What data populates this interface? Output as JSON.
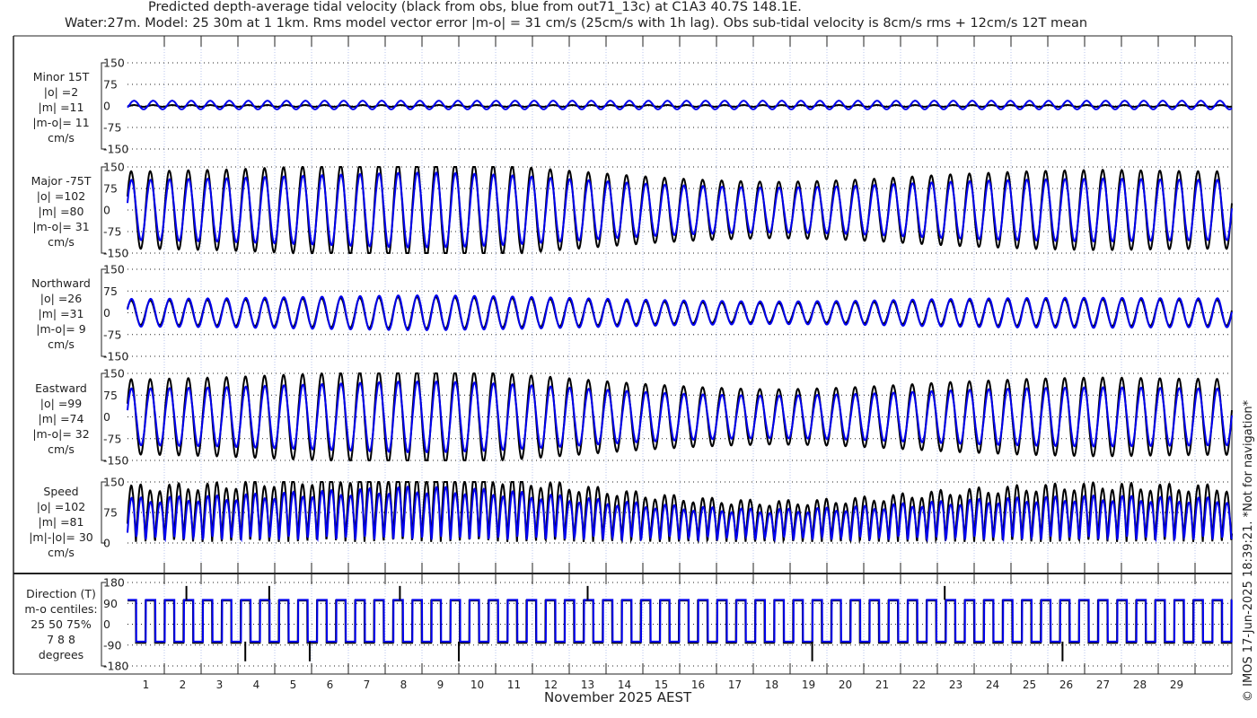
{
  "title_line1": "Predicted depth-average tidal velocity (black from obs, blue from out71_13c) at C1A3 40.7S 148.1E.",
  "title_line2": "Water:27m. Model: 25 30m at 1 1km. Rms model vector error |m-o| = 31 cm/s (25cm/s with 1h lag). Obs sub-tidal velocity is 8cm/s rms + 12cm/s 12T mean",
  "xlabel": "November 2025 AEST",
  "copyright": "© IMOS 17-Jun-2025 18:39:21. *Not for navigation*",
  "colors": {
    "obs": "#000000",
    "model": "#0000ee",
    "grid": "#000000",
    "vgrid": "#b8c4ee"
  },
  "chart_data": {
    "type": "line",
    "x_unit": "day of November 2025",
    "xlim": [
      1,
      31
    ],
    "x_tick_labels": [
      "1",
      "2",
      "3",
      "4",
      "5",
      "6",
      "7",
      "8",
      "9",
      "10",
      "11",
      "12",
      "13",
      "14",
      "15",
      "16",
      "17",
      "18",
      "19",
      "20",
      "21",
      "22",
      "23",
      "24",
      "25",
      "26",
      "27",
      "28",
      "29"
    ],
    "tidal_period_hours": 12.42,
    "legend": {
      "obs": "black from obs",
      "model": "blue from out71_13c"
    },
    "panels": [
      {
        "id": "minor",
        "label": [
          "Minor 15T",
          "|o| =2",
          "|m| =11",
          "|m-o|= 11",
          "cm/s"
        ],
        "ylim": [
          -150,
          150
        ],
        "yticks": [
          "150",
          "75",
          "0",
          "-75",
          "-150"
        ],
        "ytick_values": [
          150,
          75,
          0,
          -75,
          -150
        ],
        "obs_amplitude_cm_s": 3,
        "model_amplitude_cm_s": 15
      },
      {
        "id": "major",
        "label": [
          "Major -75T",
          "|o| =102",
          "|m| =80",
          "|m-o|= 31",
          "cm/s"
        ],
        "ylim": [
          -150,
          150
        ],
        "yticks": [
          "150",
          "75",
          "0",
          "-75",
          "-150"
        ],
        "ytick_values": [
          150,
          75,
          0,
          -75,
          -150
        ],
        "obs_envelope_daily": [
          135,
          138,
          140,
          145,
          150,
          155,
          160,
          165,
          165,
          160,
          152,
          142,
          132,
          122,
          113,
          106,
          101,
          98,
          100,
          104,
          110,
          118,
          125,
          130,
          135,
          138,
          140,
          138,
          136,
          135
        ],
        "model_envelope_daily": [
          105,
          108,
          110,
          114,
          118,
          122,
          126,
          130,
          130,
          126,
          120,
          112,
          104,
          96,
          89,
          84,
          80,
          78,
          80,
          83,
          88,
          94,
          99,
          103,
          106,
          108,
          110,
          108,
          106,
          105
        ]
      },
      {
        "id": "northward",
        "label": [
          "Northward",
          "|o| =26",
          "|m| =31",
          "|m-o|= 9",
          "cm/s"
        ],
        "ylim": [
          -150,
          150
        ],
        "yticks": [
          "150",
          "75",
          "0",
          "-75",
          "-150"
        ],
        "ytick_values": [
          150,
          75,
          0,
          -75,
          -150
        ],
        "obs_envelope_daily": [
          42,
          43,
          44,
          46,
          48,
          50,
          52,
          54,
          54,
          52,
          50,
          47,
          44,
          41,
          38,
          36,
          34,
          33,
          34,
          35,
          37,
          40,
          42,
          44,
          45,
          46,
          46,
          45,
          44,
          44
        ],
        "model_envelope_daily": [
          48,
          49,
          50,
          52,
          54,
          56,
          58,
          60,
          60,
          58,
          56,
          53,
          50,
          47,
          44,
          42,
          40,
          39,
          40,
          41,
          43,
          46,
          48,
          50,
          51,
          52,
          52,
          51,
          50,
          50
        ]
      },
      {
        "id": "eastward",
        "label": [
          "Eastward",
          "|o| =99",
          "|m| =74",
          "|m-o|= 32",
          "cm/s"
        ],
        "ylim": [
          -150,
          150
        ],
        "yticks": [
          "150",
          "75",
          "0",
          "-75",
          "-150"
        ],
        "ytick_values": [
          150,
          75,
          0,
          -75,
          -150
        ],
        "obs_envelope_daily": [
          130,
          133,
          136,
          141,
          146,
          151,
          156,
          160,
          160,
          155,
          147,
          138,
          128,
          118,
          110,
          103,
          98,
          95,
          97,
          101,
          107,
          114,
          121,
          126,
          131,
          134,
          136,
          134,
          132,
          131
        ],
        "model_envelope_daily": [
          98,
          100,
          102,
          106,
          110,
          114,
          118,
          122,
          122,
          118,
          112,
          105,
          97,
          90,
          83,
          78,
          75,
          73,
          75,
          78,
          82,
          87,
          92,
          96,
          99,
          101,
          102,
          101,
          99,
          98
        ]
      },
      {
        "id": "speed",
        "label": [
          "Speed",
          "|o| =102",
          "|m| =81",
          "|m|-|o|= 30",
          "cm/s"
        ],
        "ylim": [
          0,
          150
        ],
        "yticks": [
          "150",
          "75",
          "0"
        ],
        "ytick_values": [
          150,
          75,
          0
        ]
      },
      {
        "id": "direction",
        "label": [
          "Direction (T)",
          "m-o centiles:",
          "25  50  75%",
          "7  8  8",
          "degrees"
        ],
        "ylim": [
          -180,
          180
        ],
        "yticks": [
          "180",
          "90",
          "0",
          "-90",
          "-180"
        ],
        "ytick_values": [
          180,
          90,
          0,
          -90,
          -180
        ],
        "flood_direction_deg": 105,
        "ebb_direction_deg": -75,
        "obs_spike_days": [
          2.6,
          4.2,
          4.85,
          5.95,
          8.4,
          10.0,
          13.5,
          19.6,
          23.2,
          26.4
        ]
      }
    ]
  }
}
